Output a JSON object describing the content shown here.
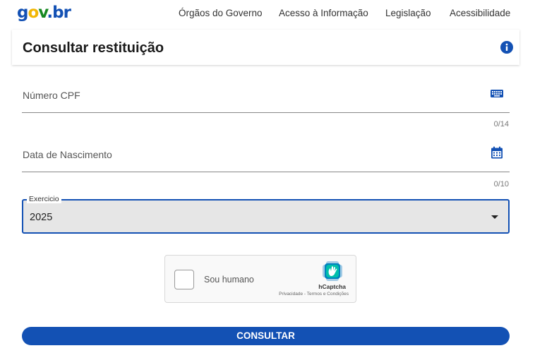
{
  "header": {
    "logo": {
      "g": "g",
      "o": "o",
      "v": "v",
      "dot": ".",
      "br": "br"
    },
    "nav": [
      "Órgãos do Governo",
      "Acesso à Informação",
      "Legislação",
      "Acessibilidade"
    ]
  },
  "page": {
    "title": "Consultar restituição",
    "info_icon": "info-circle-icon"
  },
  "form": {
    "cpf": {
      "label": "Número CPF",
      "counter": "0/14",
      "icon": "keyboard-icon"
    },
    "birth": {
      "label": "Data de Nascimento",
      "counter": "0/10",
      "icon": "calendar-icon"
    },
    "exercicio": {
      "label": "Exercicio",
      "value": "2025",
      "icon": "caret-down-icon"
    }
  },
  "captcha": {
    "label": "Sou humano",
    "brand": "hCaptcha",
    "links": "Privacidade - Termos e Condições"
  },
  "submit_label": "CONSULTAR",
  "colors": {
    "primary": "#1351b4",
    "select_bg": "#e6e6e6",
    "text": "#333333"
  }
}
